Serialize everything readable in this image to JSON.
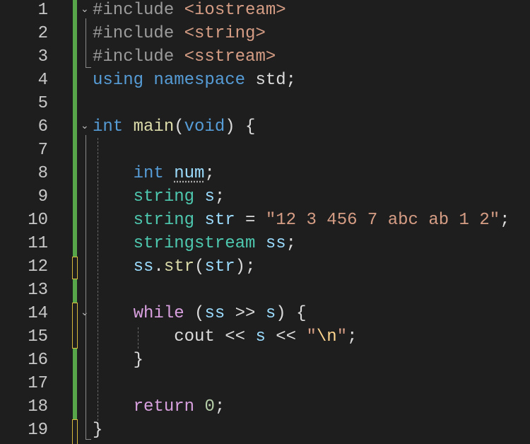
{
  "editor": {
    "line_numbers": [
      "1",
      "2",
      "3",
      "4",
      "5",
      "6",
      "7",
      "8",
      "9",
      "10",
      "11",
      "12",
      "13",
      "14",
      "15",
      "16",
      "17",
      "18",
      "19"
    ],
    "lines": [
      [
        {
          "t": "#include ",
          "k": "pp"
        },
        {
          "t": "<iostream>",
          "k": "inc"
        }
      ],
      [
        {
          "t": "#include ",
          "k": "pp"
        },
        {
          "t": "<string>",
          "k": "inc"
        }
      ],
      [
        {
          "t": "#include ",
          "k": "pp"
        },
        {
          "t": "<sstream>",
          "k": "inc"
        }
      ],
      [
        {
          "t": "using ",
          "k": "kw"
        },
        {
          "t": "namespace ",
          "k": "kw"
        },
        {
          "t": "std;",
          "k": "pl"
        }
      ],
      [],
      [
        {
          "t": "int ",
          "k": "kw"
        },
        {
          "t": "main",
          "k": "fn"
        },
        {
          "t": "(",
          "k": "pl"
        },
        {
          "t": "void",
          "k": "kw"
        },
        {
          "t": ") {",
          "k": "pl"
        }
      ],
      [],
      [
        {
          "t": "    int ",
          "k": "kw"
        },
        {
          "t": "num",
          "k": "var sq"
        },
        {
          "t": ";",
          "k": "pl"
        }
      ],
      [
        {
          "t": "    string ",
          "k": "ty"
        },
        {
          "t": "s",
          "k": "var"
        },
        {
          "t": ";",
          "k": "pl"
        }
      ],
      [
        {
          "t": "    string ",
          "k": "ty"
        },
        {
          "t": "str",
          "k": "var"
        },
        {
          "t": " = ",
          "k": "pl"
        },
        {
          "t": "\"12 3 456 7 abc ab 1 2\"",
          "k": "str"
        },
        {
          "t": ";",
          "k": "pl"
        }
      ],
      [
        {
          "t": "    stringstream ",
          "k": "ty"
        },
        {
          "t": "ss",
          "k": "var"
        },
        {
          "t": ";",
          "k": "pl"
        }
      ],
      [
        {
          "t": "    ss",
          "k": "var"
        },
        {
          "t": ".",
          "k": "pl"
        },
        {
          "t": "str",
          "k": "fn"
        },
        {
          "t": "(",
          "k": "pl"
        },
        {
          "t": "str",
          "k": "var"
        },
        {
          "t": ");",
          "k": "pl"
        }
      ],
      [],
      [
        {
          "t": "    while ",
          "k": "ctl"
        },
        {
          "t": "(",
          "k": "pl"
        },
        {
          "t": "ss",
          "k": "var"
        },
        {
          "t": " >> ",
          "k": "pl"
        },
        {
          "t": "s",
          "k": "var"
        },
        {
          "t": ") {",
          "k": "pl"
        }
      ],
      [
        {
          "t": "        cout ",
          "k": "pl"
        },
        {
          "t": "<< ",
          "k": "pl"
        },
        {
          "t": "s",
          "k": "var"
        },
        {
          "t": " << ",
          "k": "pl"
        },
        {
          "t": "\"",
          "k": "str"
        },
        {
          "t": "\\n",
          "k": "esc"
        },
        {
          "t": "\"",
          "k": "str"
        },
        {
          "t": ";",
          "k": "pl"
        }
      ],
      [
        {
          "t": "    }",
          "k": "pl"
        }
      ],
      [],
      [
        {
          "t": "    return ",
          "k": "ctl"
        },
        {
          "t": "0",
          "k": "num"
        },
        {
          "t": ";",
          "k": "pl"
        }
      ],
      [
        {
          "t": "}",
          "k": "pl"
        }
      ]
    ],
    "colors": {
      "background": "#1e1e1e",
      "change_bar": "#57a64a",
      "modified_marker": "#d7ba3d"
    }
  }
}
